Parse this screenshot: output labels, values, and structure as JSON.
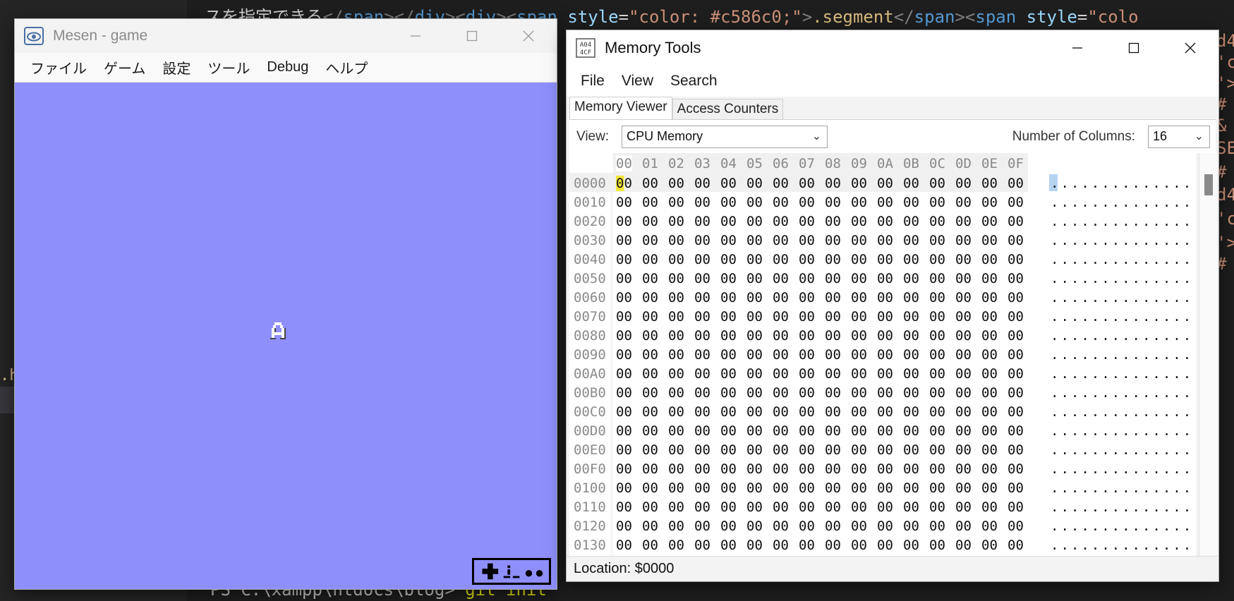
{
  "background_editor": {
    "code_lines": [
      {
        "pre": "スを指定できる",
        "segments": [
          {
            "t": "</",
            "c": "ang"
          },
          {
            "t": "span",
            "c": "tag"
          },
          {
            "t": "></",
            "c": "ang"
          },
          {
            "t": "div",
            "c": "tag"
          },
          {
            "t": "><",
            "c": "ang"
          },
          {
            "t": "div",
            "c": "tag"
          },
          {
            "t": "><",
            "c": "ang"
          },
          {
            "t": "span",
            "c": "tag"
          },
          {
            "t": " style",
            "c": "attr"
          },
          {
            "t": "=",
            "c": ""
          },
          {
            "t": "\"color: #c586c0;\"",
            "c": "str"
          },
          {
            "t": ">",
            "c": "ang"
          },
          {
            "t": ".segment",
            "c": "cls"
          },
          {
            "t": "</",
            "c": "ang"
          },
          {
            "t": "span",
            "c": "tag"
          },
          {
            "t": "><",
            "c": "ang"
          },
          {
            "t": "span",
            "c": "tag"
          },
          {
            "t": " style",
            "c": "attr"
          },
          {
            "t": "=",
            "c": ""
          },
          {
            "t": "\"colo",
            "c": "str"
          }
        ]
      }
    ],
    "right_strip": [
      "d4",
      "'c",
      "'>",
      "#",
      "&",
      "SE",
      "#",
      "d4",
      "'c",
      "'>",
      "#"
    ],
    "terminal_prompt": "PS C:\\xampp\\htdocs\\blog>",
    "terminal_command": "git init",
    "file_fragment": ".ht"
  },
  "mesen": {
    "title": "Mesen - game",
    "icon": "eye-icon",
    "menu": [
      "ファイル",
      "ゲーム",
      "設定",
      "ツール",
      "Debug",
      "ヘルプ"
    ],
    "screen_color": "#8f8ffc",
    "sprite_char": "A"
  },
  "memory_tools": {
    "title": "Memory Tools",
    "icon": "hex-memory-icon",
    "menu": [
      "File",
      "View",
      "Search"
    ],
    "tabs": [
      "Memory Viewer",
      "Access Counters"
    ],
    "active_tab": "Memory Viewer",
    "view_label": "View:",
    "view_value": "CPU Memory",
    "columns_label": "Number of Columns:",
    "columns_value": "16",
    "column_headers": [
      "00",
      "01",
      "02",
      "03",
      "04",
      "05",
      "06",
      "07",
      "08",
      "09",
      "0A",
      "0B",
      "0C",
      "0D",
      "0E",
      "0F"
    ],
    "rows": [
      {
        "addr": "0000",
        "bytes": [
          "00",
          "00",
          "00",
          "00",
          "00",
          "00",
          "00",
          "00",
          "00",
          "00",
          "00",
          "00",
          "00",
          "00",
          "00",
          "00"
        ],
        "ascii": "................"
      },
      {
        "addr": "0010",
        "bytes": [
          "00",
          "00",
          "00",
          "00",
          "00",
          "00",
          "00",
          "00",
          "00",
          "00",
          "00",
          "00",
          "00",
          "00",
          "00",
          "00"
        ],
        "ascii": "................"
      },
      {
        "addr": "0020",
        "bytes": [
          "00",
          "00",
          "00",
          "00",
          "00",
          "00",
          "00",
          "00",
          "00",
          "00",
          "00",
          "00",
          "00",
          "00",
          "00",
          "00"
        ],
        "ascii": "................"
      },
      {
        "addr": "0030",
        "bytes": [
          "00",
          "00",
          "00",
          "00",
          "00",
          "00",
          "00",
          "00",
          "00",
          "00",
          "00",
          "00",
          "00",
          "00",
          "00",
          "00"
        ],
        "ascii": "................"
      },
      {
        "addr": "0040",
        "bytes": [
          "00",
          "00",
          "00",
          "00",
          "00",
          "00",
          "00",
          "00",
          "00",
          "00",
          "00",
          "00",
          "00",
          "00",
          "00",
          "00"
        ],
        "ascii": "................"
      },
      {
        "addr": "0050",
        "bytes": [
          "00",
          "00",
          "00",
          "00",
          "00",
          "00",
          "00",
          "00",
          "00",
          "00",
          "00",
          "00",
          "00",
          "00",
          "00",
          "00"
        ],
        "ascii": "................"
      },
      {
        "addr": "0060",
        "bytes": [
          "00",
          "00",
          "00",
          "00",
          "00",
          "00",
          "00",
          "00",
          "00",
          "00",
          "00",
          "00",
          "00",
          "00",
          "00",
          "00"
        ],
        "ascii": "................"
      },
      {
        "addr": "0070",
        "bytes": [
          "00",
          "00",
          "00",
          "00",
          "00",
          "00",
          "00",
          "00",
          "00",
          "00",
          "00",
          "00",
          "00",
          "00",
          "00",
          "00"
        ],
        "ascii": "................"
      },
      {
        "addr": "0080",
        "bytes": [
          "00",
          "00",
          "00",
          "00",
          "00",
          "00",
          "00",
          "00",
          "00",
          "00",
          "00",
          "00",
          "00",
          "00",
          "00",
          "00"
        ],
        "ascii": "................"
      },
      {
        "addr": "0090",
        "bytes": [
          "00",
          "00",
          "00",
          "00",
          "00",
          "00",
          "00",
          "00",
          "00",
          "00",
          "00",
          "00",
          "00",
          "00",
          "00",
          "00"
        ],
        "ascii": "................"
      },
      {
        "addr": "00A0",
        "bytes": [
          "00",
          "00",
          "00",
          "00",
          "00",
          "00",
          "00",
          "00",
          "00",
          "00",
          "00",
          "00",
          "00",
          "00",
          "00",
          "00"
        ],
        "ascii": "................"
      },
      {
        "addr": "00B0",
        "bytes": [
          "00",
          "00",
          "00",
          "00",
          "00",
          "00",
          "00",
          "00",
          "00",
          "00",
          "00",
          "00",
          "00",
          "00",
          "00",
          "00"
        ],
        "ascii": "................"
      },
      {
        "addr": "00C0",
        "bytes": [
          "00",
          "00",
          "00",
          "00",
          "00",
          "00",
          "00",
          "00",
          "00",
          "00",
          "00",
          "00",
          "00",
          "00",
          "00",
          "00"
        ],
        "ascii": "................"
      },
      {
        "addr": "00D0",
        "bytes": [
          "00",
          "00",
          "00",
          "00",
          "00",
          "00",
          "00",
          "00",
          "00",
          "00",
          "00",
          "00",
          "00",
          "00",
          "00",
          "00"
        ],
        "ascii": "................"
      },
      {
        "addr": "00E0",
        "bytes": [
          "00",
          "00",
          "00",
          "00",
          "00",
          "00",
          "00",
          "00",
          "00",
          "00",
          "00",
          "00",
          "00",
          "00",
          "00",
          "00"
        ],
        "ascii": "................"
      },
      {
        "addr": "00F0",
        "bytes": [
          "00",
          "00",
          "00",
          "00",
          "00",
          "00",
          "00",
          "00",
          "00",
          "00",
          "00",
          "00",
          "00",
          "00",
          "00",
          "00"
        ],
        "ascii": "................"
      },
      {
        "addr": "0100",
        "bytes": [
          "00",
          "00",
          "00",
          "00",
          "00",
          "00",
          "00",
          "00",
          "00",
          "00",
          "00",
          "00",
          "00",
          "00",
          "00",
          "00"
        ],
        "ascii": "................"
      },
      {
        "addr": "0110",
        "bytes": [
          "00",
          "00",
          "00",
          "00",
          "00",
          "00",
          "00",
          "00",
          "00",
          "00",
          "00",
          "00",
          "00",
          "00",
          "00",
          "00"
        ],
        "ascii": "................"
      },
      {
        "addr": "0120",
        "bytes": [
          "00",
          "00",
          "00",
          "00",
          "00",
          "00",
          "00",
          "00",
          "00",
          "00",
          "00",
          "00",
          "00",
          "00",
          "00",
          "00"
        ],
        "ascii": "................"
      },
      {
        "addr": "0130",
        "bytes": [
          "00",
          "00",
          "00",
          "00",
          "00",
          "00",
          "00",
          "00",
          "00",
          "00",
          "00",
          "00",
          "00",
          "00",
          "00",
          "00"
        ],
        "ascii": "................"
      }
    ],
    "cursor": {
      "row": 0,
      "col": 0
    },
    "cursor_color": "#f2e73a",
    "ascii_selection_color": "#b7d3f2",
    "status": "Location: $0000"
  }
}
